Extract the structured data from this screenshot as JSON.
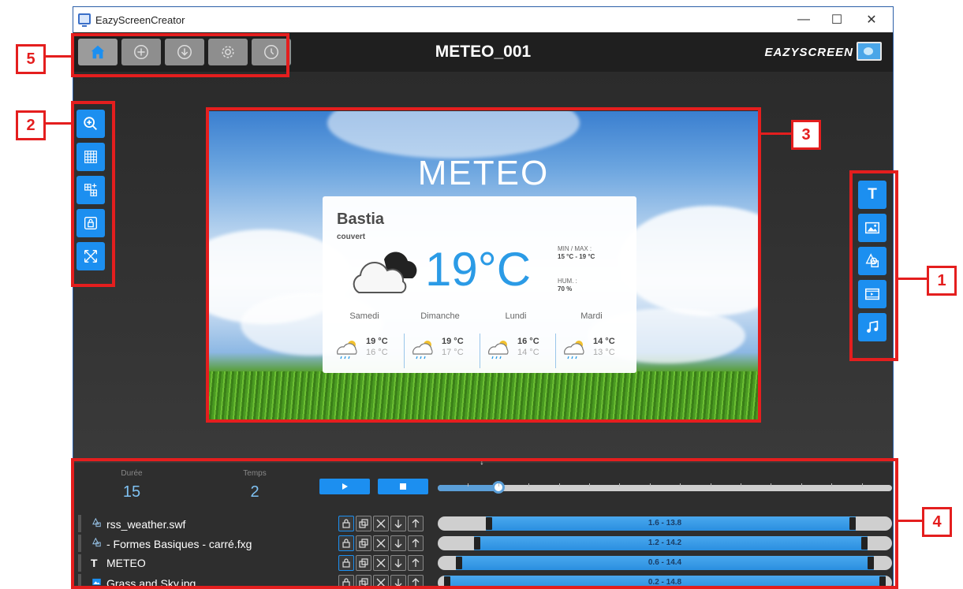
{
  "window": {
    "title": "EazyScreenCreator"
  },
  "header": {
    "doc_title": "METEO_001",
    "brand": "EAZYSCREEN",
    "toolbar": [
      "home-icon",
      "add-circle-icon",
      "download-circle-icon",
      "gear-icon",
      "clock-icon"
    ]
  },
  "left_tools": [
    "zoom-in-icon",
    "grid-icon",
    "grid-add-icon",
    "lock-icon",
    "expand-icon"
  ],
  "right_tools": [
    "text-icon",
    "image-icon",
    "shapes-icon",
    "video-icon",
    "music-icon"
  ],
  "canvas": {
    "title": "METEO",
    "city": "Bastia",
    "condition": "couvert",
    "temperature": "19°C",
    "minmax_label": "MIN / MAX :",
    "minmax_value": "15 °C  -  19 °C",
    "hum_label": "HUM. :",
    "hum_value": "70 %",
    "forecast": [
      {
        "day": "Samedi",
        "hi": "19 °C",
        "lo": "16 °C"
      },
      {
        "day": "Dimanche",
        "hi": "19 °C",
        "lo": "17 °C"
      },
      {
        "day": "Lundi",
        "hi": "16 °C",
        "lo": "14 °C"
      },
      {
        "day": "Mardi",
        "hi": "14 °C",
        "lo": "13 °C"
      }
    ]
  },
  "timeline": {
    "duree_label": "Durée",
    "duree_value": "15",
    "temps_label": "Temps",
    "temps_value": "2",
    "duration": 15,
    "current_time": 2,
    "layers": [
      {
        "name": "rss_weather.swf",
        "icon": "shapes-icon",
        "range": "1.6 - 13.8",
        "start": 1.6,
        "end": 13.8
      },
      {
        "name": "- Formes Basiques - carré.fxg",
        "icon": "shapes-icon",
        "range": "1.2 - 14.2",
        "start": 1.2,
        "end": 14.2
      },
      {
        "name": "METEO",
        "icon": "text-icon",
        "icon_text": "T",
        "range": "0.6 - 14.4",
        "start": 0.6,
        "end": 14.4
      },
      {
        "name": "Grass and Sky.jpg",
        "icon": "image-icon",
        "range": "0.2 - 14.8",
        "start": 0.2,
        "end": 14.8
      }
    ]
  },
  "annotations": [
    "1",
    "2",
    "3",
    "4",
    "5"
  ],
  "colors": {
    "accent": "#1c8ff0",
    "annotation": "#e41e1e",
    "temp": "#2b9be6"
  }
}
